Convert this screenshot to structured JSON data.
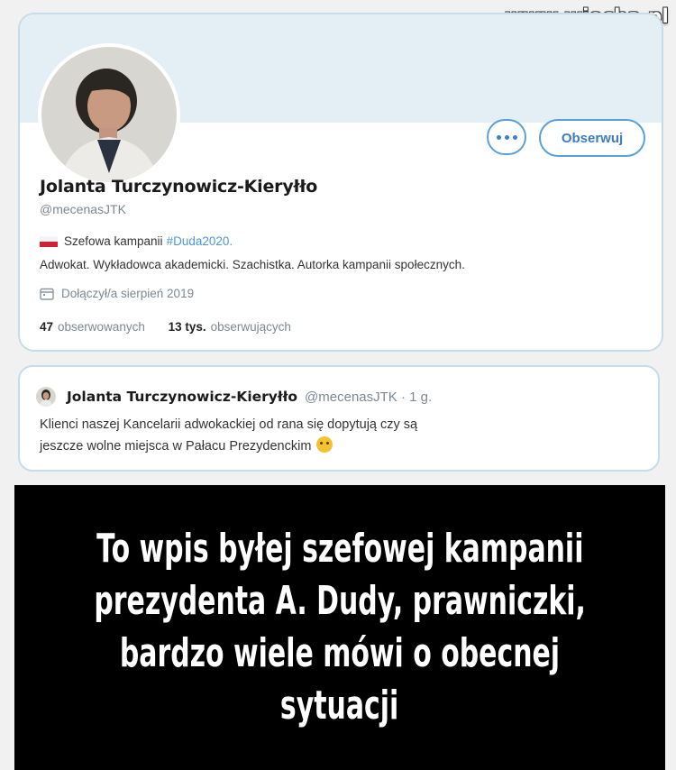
{
  "watermark": "www.wiocha.pl",
  "profile": {
    "follow_label": "Obserwuj",
    "more_icon": "more-icon",
    "name": "Jolanta Turczynowicz-Kieryłło",
    "handle": "@mecenasJTK",
    "bio_line1": "Szefowa kampanii",
    "bio_hashtag": "#Duda2020.",
    "bio_line2": "Adwokat. Wykładowca akademicki. Szachistka. Autorka kampanii społecznych.",
    "joined": "Dołączył/a sierpień 2019",
    "following_count": "47",
    "following_label": "obserwowanych",
    "followers_count": "13 tys.",
    "followers_label": "obserwujących"
  },
  "tweet": {
    "name": "Jolanta Turczynowicz-Kieryłło",
    "meta": "@mecenasJTK · 1 g.",
    "line1": "Klienci naszej Kancelarii adwokackiej od rana się dopytują czy są",
    "line2": "jeszcze wolne miejsca w Pałacu Prezydenckim"
  },
  "caption": {
    "line1": "To wpis byłej szefowej kampanii",
    "line2": "prezydenta A. Dudy, prawniczki,",
    "line3": "bardzo wiele mówi o obecnej",
    "line4": "sytuacji"
  },
  "colors": {
    "accent": "#3b7cc0",
    "hashtag": "#4a99d6",
    "card_border": "#c6dce9",
    "banner": "#e3eef5"
  }
}
